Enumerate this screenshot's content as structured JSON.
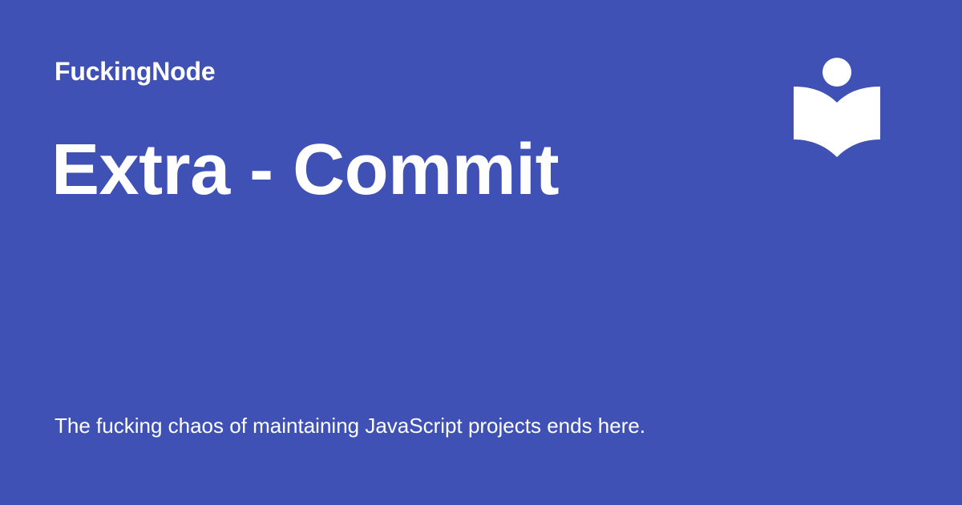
{
  "site": {
    "name": "FuckingNode"
  },
  "page": {
    "title": "Extra - Commit",
    "tagline": "The fucking chaos of maintaining JavaScript projects ends here."
  },
  "logo": {
    "icon": "reader-book-icon"
  },
  "colors": {
    "background": "#3f51b5",
    "text": "#ffffff"
  }
}
